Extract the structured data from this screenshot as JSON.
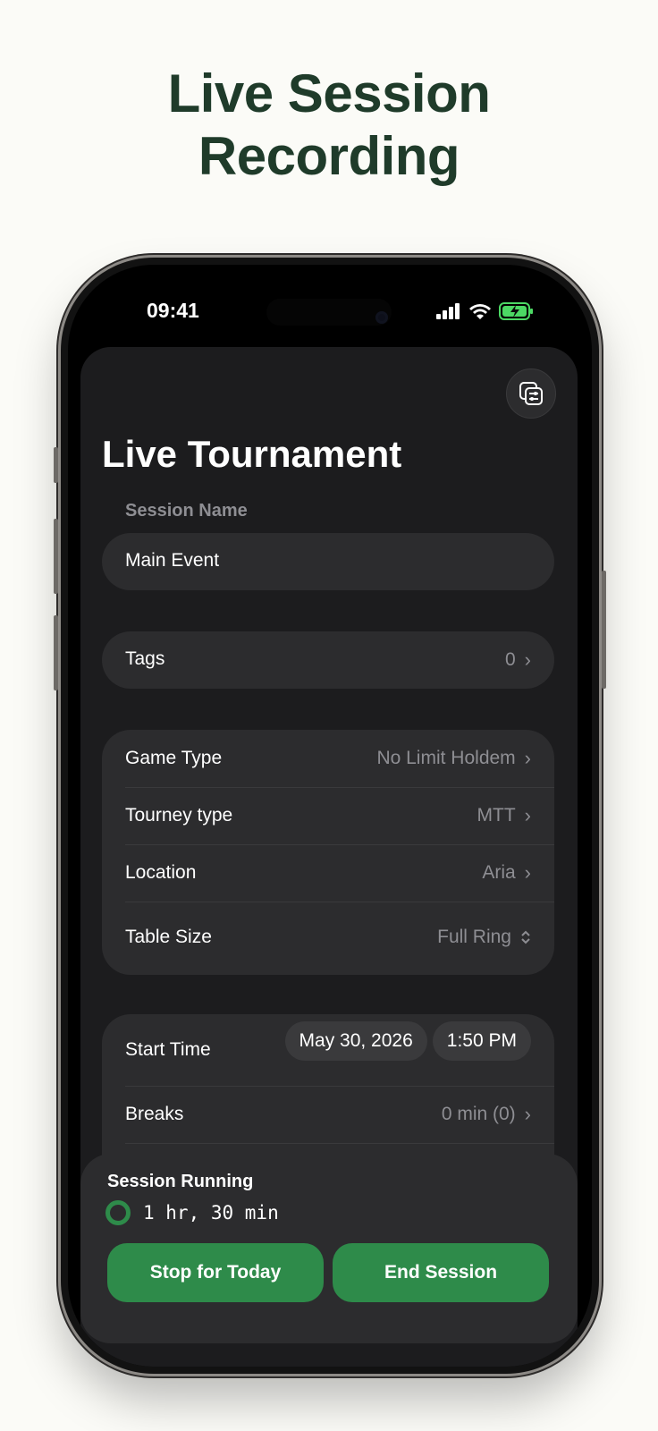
{
  "headline": {
    "line1": "Live Session",
    "line2": "Recording"
  },
  "status_bar": {
    "time": "09:41"
  },
  "screen": {
    "title": "Live Tournament",
    "session_name_label": "Session Name",
    "session_name_value": "Main Event",
    "tags": {
      "label": "Tags",
      "value": "0"
    },
    "game_group": [
      {
        "label": "Game Type",
        "value": "No Limit Holdem",
        "icon": "chevron-right"
      },
      {
        "label": "Tourney type",
        "value": "MTT",
        "icon": "chevron-right"
      },
      {
        "label": "Location",
        "value": "Aria",
        "icon": "chevron-right"
      },
      {
        "label": "Table Size",
        "value": "Full Ring",
        "icon": "chevron-up-down"
      }
    ],
    "start_time": {
      "label": "Start Time",
      "date": "May 30, 2026",
      "time": "1:50 PM"
    },
    "breaks": {
      "label": "Breaks",
      "value": "0 min (0)"
    }
  },
  "bottom_bar": {
    "title": "Session Running",
    "timer": "1 hr, 30 min",
    "stop_label": "Stop for Today",
    "end_label": "End Session"
  },
  "colors": {
    "accent": "#2e8b4a",
    "headline": "#1f3b2a",
    "background": "#fbfbf7"
  }
}
